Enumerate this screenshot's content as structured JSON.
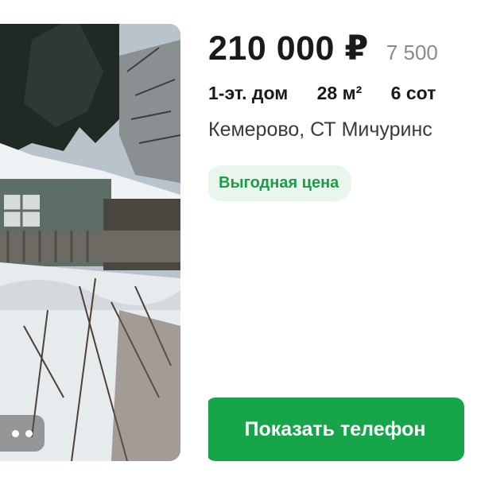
{
  "listing": {
    "price": "210 000 ₽",
    "price_per": "7 500",
    "params": [
      "1-эт. дом",
      "28 м²",
      "6 сот"
    ],
    "address": "Кемерово, СТ Мичуринс",
    "badge": "Выгодная цена",
    "show_phone_label": "Показать телефон"
  },
  "colors": {
    "accent_green": "#16a548",
    "badge_bg": "#e8f6ec",
    "badge_text": "#1f9a4a"
  },
  "icons": {
    "gallery": "more-dots-icon"
  }
}
